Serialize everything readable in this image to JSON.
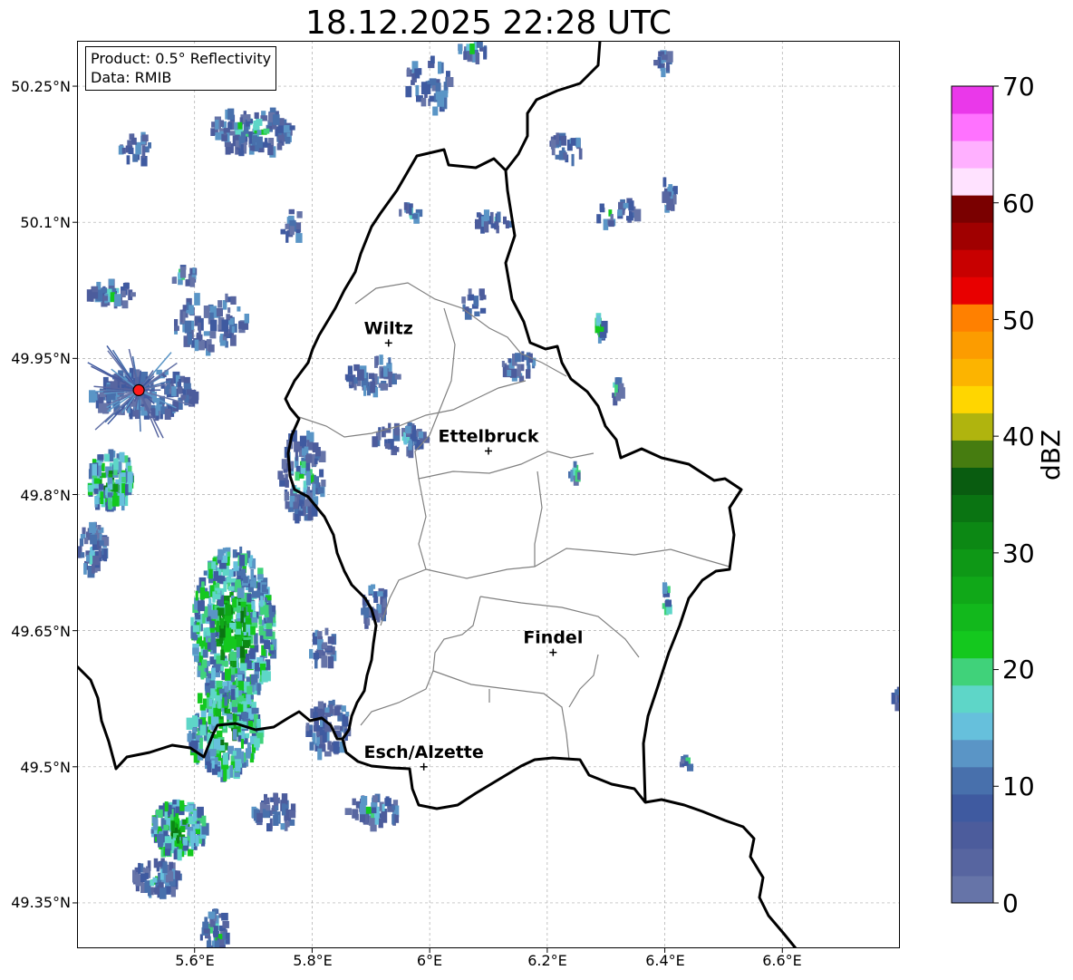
{
  "title": "18.12.2025 22:28 UTC",
  "info": {
    "product": "Product: 0.5° Reflectivity",
    "data": "Data: RMIB"
  },
  "map": {
    "lon_range": [
      5.4,
      6.8
    ],
    "lat_range": [
      49.3,
      50.3
    ],
    "lat_ticks": [
      "50.25°N",
      "50.1°N",
      "49.95°N",
      "49.8°N",
      "49.65°N",
      "49.5°N",
      "49.35°N"
    ],
    "lon_ticks": [
      "5.6°E",
      "5.8°E",
      "6°E",
      "6.2°E",
      "6.4°E",
      "6.6°E"
    ],
    "cities": [
      {
        "name": "Wiltz",
        "lon": 5.93,
        "lat": 49.967
      },
      {
        "name": "Ettelbruck",
        "lon": 6.1,
        "lat": 49.848
      },
      {
        "name": "Findel",
        "lon": 6.21,
        "lat": 49.626
      },
      {
        "name": "Esch/Alzette",
        "lon": 5.99,
        "lat": 49.5
      }
    ],
    "radar_site": {
      "lon": 5.505,
      "lat": 49.915
    },
    "border_color": "#000000",
    "canton_color": "#808080"
  },
  "colorbar": {
    "label": "dBZ",
    "min": 0,
    "max": 70,
    "tick_labels": [
      "0",
      "10",
      "20",
      "30",
      "40",
      "50",
      "60",
      "70"
    ],
    "colors": [
      "#6674a8",
      "#5765a0",
      "#4c5c9c",
      "#3f5aa0",
      "#4870ac",
      "#5a95c6",
      "#66c0dc",
      "#5ed6c8",
      "#40d27a",
      "#14c81e",
      "#12b81c",
      "#10a818",
      "#0e9816",
      "#0c8814",
      "#0a7412",
      "#095c10",
      "#467c10",
      "#b0b40e",
      "#ffd600",
      "#fcb400",
      "#fc9c00",
      "#ff8000",
      "#e80000",
      "#c80000",
      "#a00000",
      "#7a0000",
      "#ffe2ff",
      "#ffb0ff",
      "#ff72ff",
      "#ea38ea"
    ]
  }
}
